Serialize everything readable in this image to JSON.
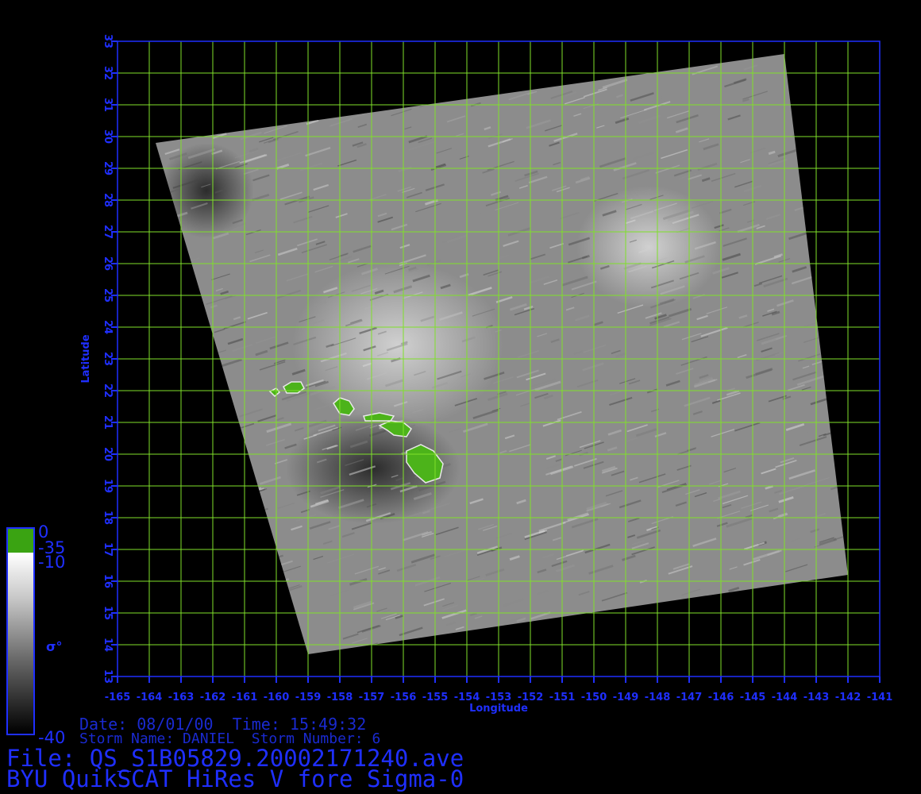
{
  "map": {
    "xlabel": "Longitude",
    "ylabel": "Latitude",
    "lon_range": [
      -165,
      -141
    ],
    "lat_range": [
      13,
      33
    ],
    "x_ticks": [
      -165,
      -164,
      -163,
      -162,
      -161,
      -160,
      -159,
      -158,
      -157,
      -156,
      -155,
      -154,
      -153,
      -152,
      -151,
      -150,
      -149,
      -148,
      -147,
      -146,
      -145,
      -144,
      -143,
      -142,
      -141
    ],
    "y_ticks": [
      13,
      14,
      15,
      16,
      17,
      18,
      19,
      20,
      21,
      22,
      23,
      24,
      25,
      26,
      27,
      28,
      29,
      30,
      31,
      32,
      33
    ],
    "grid": true,
    "grid_color": "#7fe02a",
    "axis_color": "#1f2fff",
    "land_color": "#4cb31a",
    "swath_corners_lonlat": [
      [
        -163.8,
        29.8
      ],
      [
        -144.0,
        32.6
      ],
      [
        -142.0,
        16.2
      ],
      [
        -159.0,
        13.7
      ]
    ]
  },
  "colorbar": {
    "labels": [
      "0",
      "-35",
      "-10",
      "-40"
    ],
    "symbol": "σ°",
    "land_color": "#3aa312"
  },
  "info": {
    "date_line": "Date: 08/01/00  Time: 15:49:32",
    "storm_line": "Storm Name: DANIEL  Storm Number: 6",
    "file_line": "File: QS_S1B05829.20002171240.ave",
    "title_line": "BYU QuikSCAT HiRes V fore Sigma-0"
  }
}
